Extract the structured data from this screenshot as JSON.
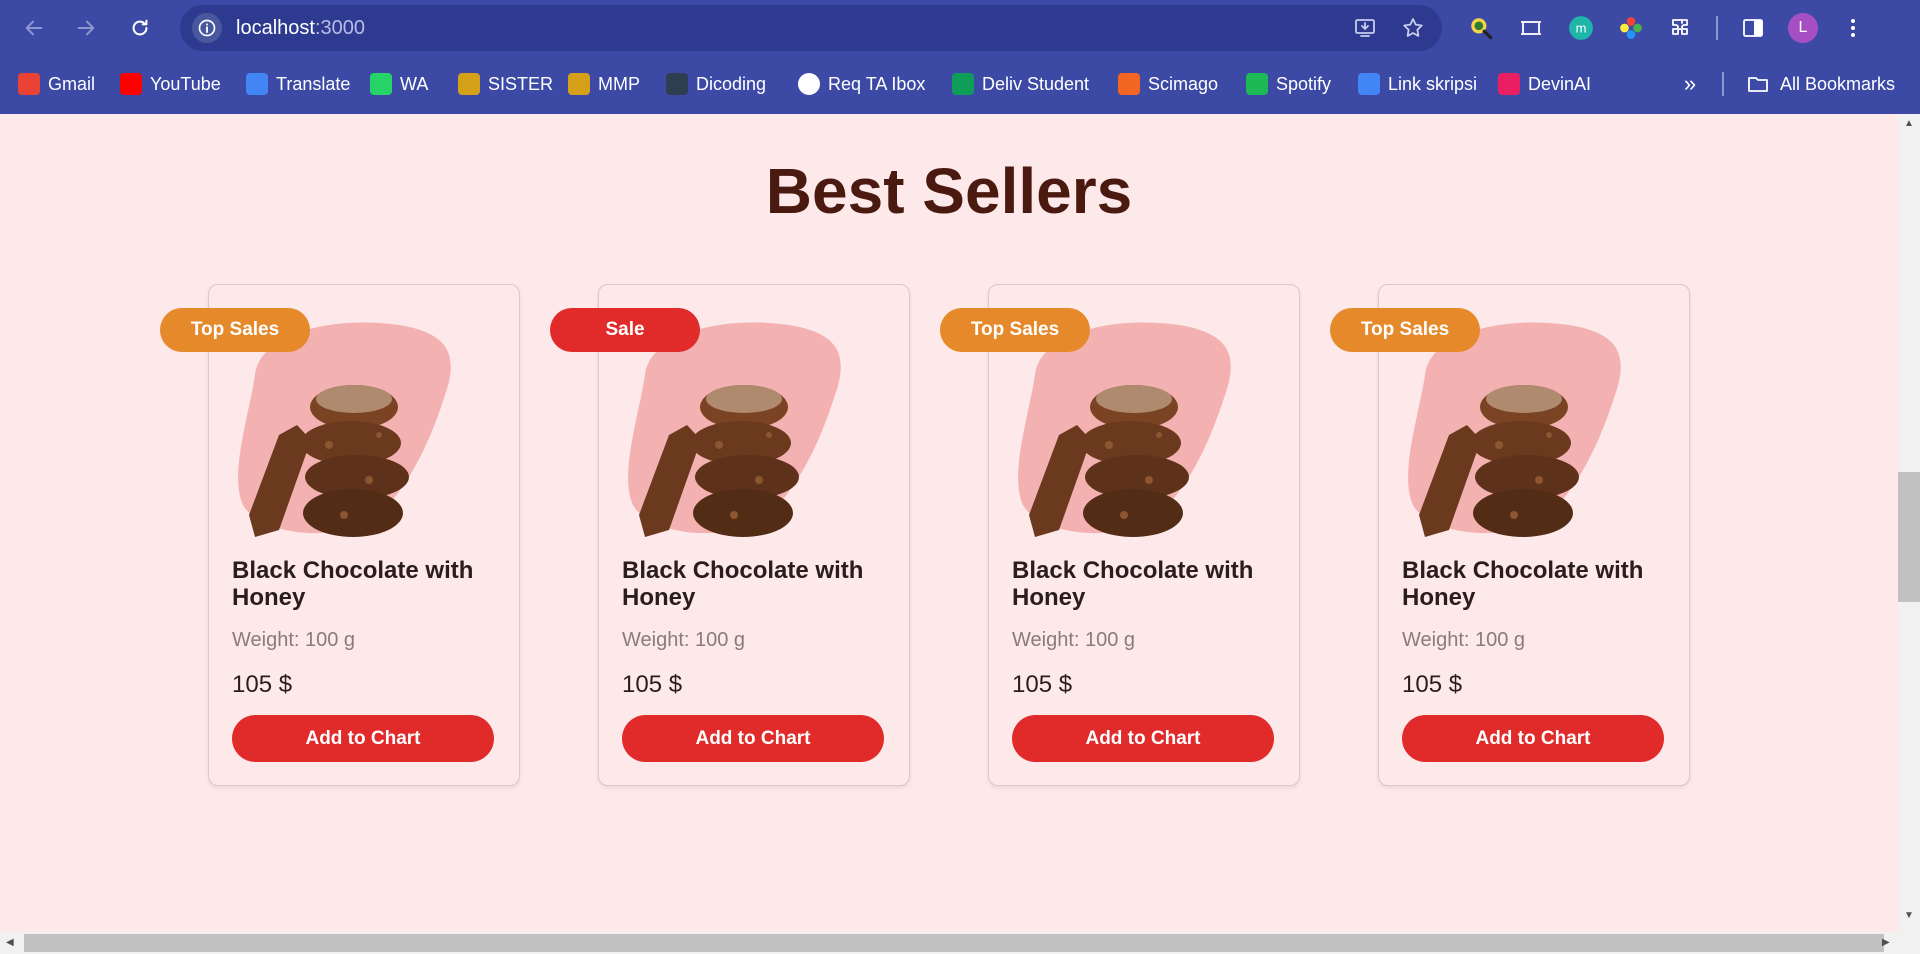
{
  "browser": {
    "url_host": "localhost",
    "url_port": ":3000",
    "profile_initial": "L",
    "bookmarks": [
      {
        "label": "Gmail",
        "icon": "gmail-icon",
        "color": "#ea4335"
      },
      {
        "label": "YouTube",
        "icon": "youtube-icon",
        "color": "#ff0000"
      },
      {
        "label": "Translate",
        "icon": "translate-icon",
        "color": "#4285f4"
      },
      {
        "label": "WA",
        "icon": "whatsapp-icon",
        "color": "#25d366"
      },
      {
        "label": "SISTER",
        "icon": "sister-icon",
        "color": "#d4a017"
      },
      {
        "label": "MMP",
        "icon": "mmp-icon",
        "color": "#d4a017"
      },
      {
        "label": "Dicoding",
        "icon": "dicoding-icon",
        "color": "#2d3e50"
      },
      {
        "label": "Req TA Ibox",
        "icon": "google-icon",
        "color": "#ffffff"
      },
      {
        "label": "Deliv Student",
        "icon": "sheets-icon",
        "color": "#0f9d58"
      },
      {
        "label": "Scimago",
        "icon": "scimago-icon",
        "color": "#f26522"
      },
      {
        "label": "Spotify",
        "icon": "spotify-icon",
        "color": "#1db954"
      },
      {
        "label": "Link skripsi",
        "icon": "docs-icon",
        "color": "#4285f4"
      },
      {
        "label": "DevinAI",
        "icon": "devinai-icon",
        "color": "#e91e63"
      }
    ],
    "more_label": "»",
    "all_bookmarks_label": "All Bookmarks"
  },
  "section": {
    "title": "Best Sellers"
  },
  "products": [
    {
      "badge": "Top Sales",
      "badge_color": "#e5892a",
      "name": "Black Chocolate with Honey",
      "weight": "Weight: 100 g",
      "price": "105 $",
      "button": "Add to Chart"
    },
    {
      "badge": "Sale",
      "badge_color": "#e12a2a",
      "name": "Black Chocolate with Honey",
      "weight": "Weight: 100 g",
      "price": "105 $",
      "button": "Add to Chart"
    },
    {
      "badge": "Top Sales",
      "badge_color": "#e5892a",
      "name": "Black Chocolate with Honey",
      "weight": "Weight: 100 g",
      "price": "105 $",
      "button": "Add to Chart"
    },
    {
      "badge": "Top Sales",
      "badge_color": "#e5892a",
      "name": "Black Chocolate with Honey",
      "weight": "Weight: 100 g",
      "price": "105 $",
      "button": "Add to Chart"
    }
  ],
  "colors": {
    "accent_red": "#e12a2a",
    "accent_orange": "#e5892a",
    "heading": "#4a1a10",
    "page_bg": "#fde9e9",
    "blob": "#f3b1b1"
  }
}
